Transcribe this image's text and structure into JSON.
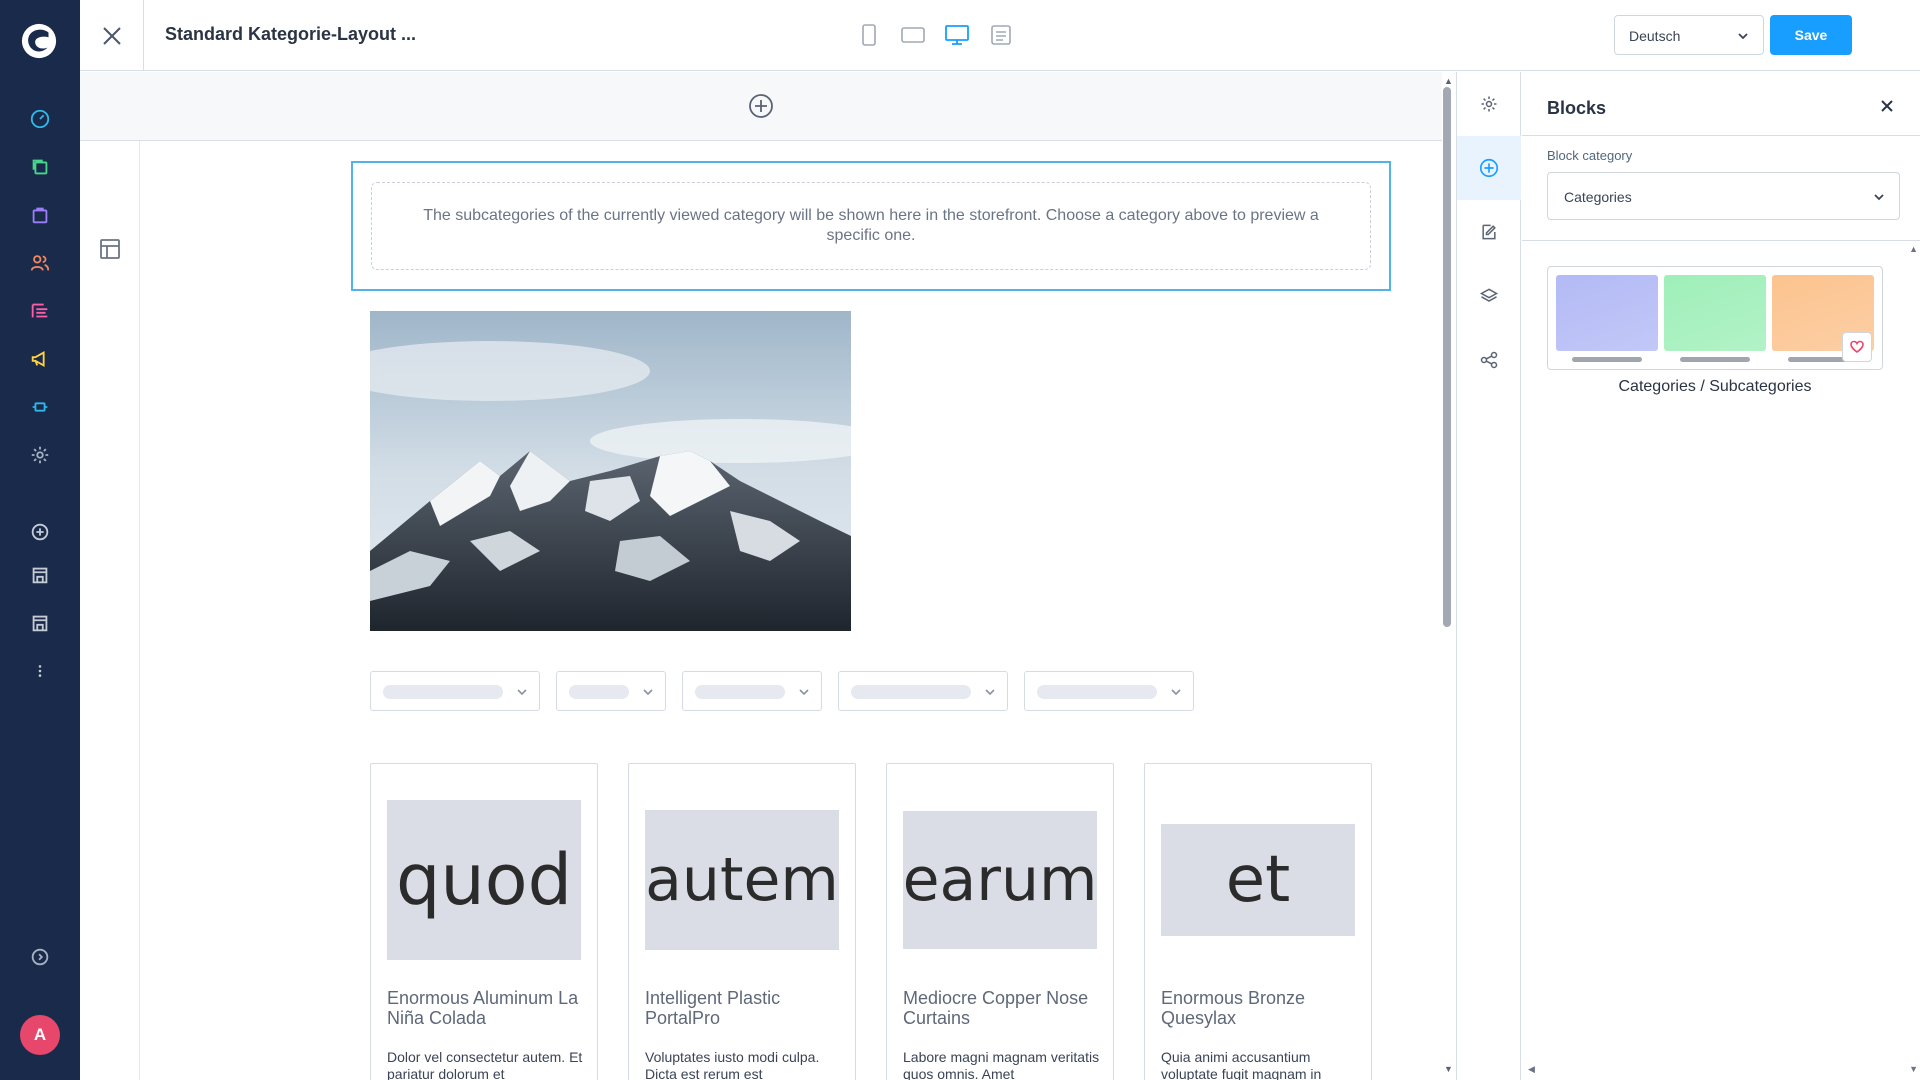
{
  "header": {
    "title": "Standard Kategorie-Layout ...",
    "language": "Deutsch",
    "save_label": "Save"
  },
  "viewports": [
    "mobile-icon",
    "tablet-icon",
    "desktop-icon",
    "form-icon"
  ],
  "active_viewport": "desktop",
  "canvas": {
    "placeholder_text": "The subcategories of the currently viewed category will be shown here in the storefront. Choose a category above to preview a specific one.",
    "products": [
      {
        "thumb_text": "quod",
        "name": "Enormous Aluminum La Niña Colada",
        "description": "Dolor vel consectetur autem. Et pariatur dolorum et"
      },
      {
        "thumb_text": "autem",
        "name": "Intelligent Plastic PortalPro",
        "description": "Voluptates iusto modi culpa. Dicta est rerum est"
      },
      {
        "thumb_text": "earum",
        "name": "Mediocre Copper Nose Curtains",
        "description": "Labore magni magnam veritatis quos omnis. Amet"
      },
      {
        "thumb_text": "et",
        "name": "Enormous Bronze Quesylax",
        "description": "Quia animi accusantium voluptate fugit magnam in"
      }
    ]
  },
  "blocks_panel": {
    "title": "Blocks",
    "category_label": "Block category",
    "category_value": "Categories",
    "block_name": "Categories / Subcategories",
    "preview_colors": [
      "#b3baf5",
      "#9fefb9",
      "#fcc38e"
    ]
  },
  "user": {
    "avatar_initial": "A"
  },
  "colors": {
    "accent": "#189eff",
    "sidebar_bg": "#1a2a4a",
    "selection": "#52b4e6"
  }
}
